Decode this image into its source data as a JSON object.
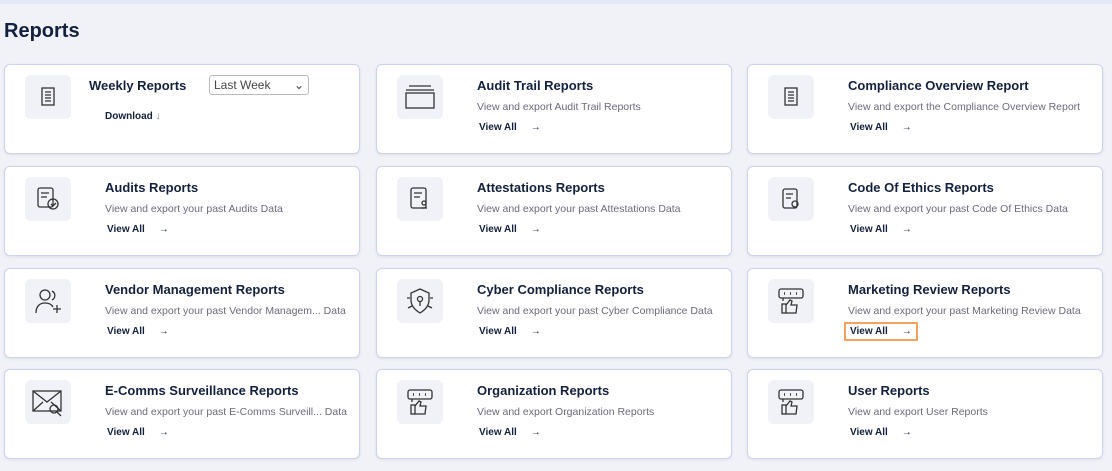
{
  "page_title": "Reports",
  "weekly": {
    "title": "Weekly Reports",
    "period": "Last Week",
    "download": "Download",
    "icon": "document-icon"
  },
  "view_all": "View All",
  "cards": [
    {
      "title": "Audit Trail Reports",
      "desc": "View and export Audit Trail Reports",
      "icon": "folder-icon"
    },
    {
      "title": "Compliance Overview Report",
      "desc": "View and export the Compliance Overview Report",
      "icon": "document-icon"
    },
    {
      "title": "Audits Reports",
      "desc": "View and export your past Audits Data",
      "icon": "audit-check-icon"
    },
    {
      "title": "Attestations Reports",
      "desc": "View and export your past Attestations Data",
      "icon": "attestation-icon"
    },
    {
      "title": "Code Of Ethics Reports",
      "desc": "View and export your past Code Of Ethics Data",
      "icon": "ethics-icon"
    },
    {
      "title": "Vendor Management Reports",
      "desc": "View and export your past Vendor Managem...   Data",
      "icon": "add-user-icon"
    },
    {
      "title": "Cyber Compliance Reports",
      "desc": "View and export your past Cyber Compliance Data",
      "icon": "shield-lock-icon"
    },
    {
      "title": "Marketing Review Reports",
      "desc": "View and export your past Marketing Review Data",
      "icon": "thumbs-up-review-icon"
    },
    {
      "title": "E-Comms Surveillance Reports",
      "desc": "View and export your past E-Comms Surveill...   Data",
      "icon": "mail-search-icon"
    },
    {
      "title": "Organization Reports",
      "desc": "View and export Organization Reports",
      "icon": "thumbs-up-review-icon"
    },
    {
      "title": "User Reports",
      "desc": "View and export User Reports",
      "icon": "thumbs-up-review-icon"
    }
  ]
}
